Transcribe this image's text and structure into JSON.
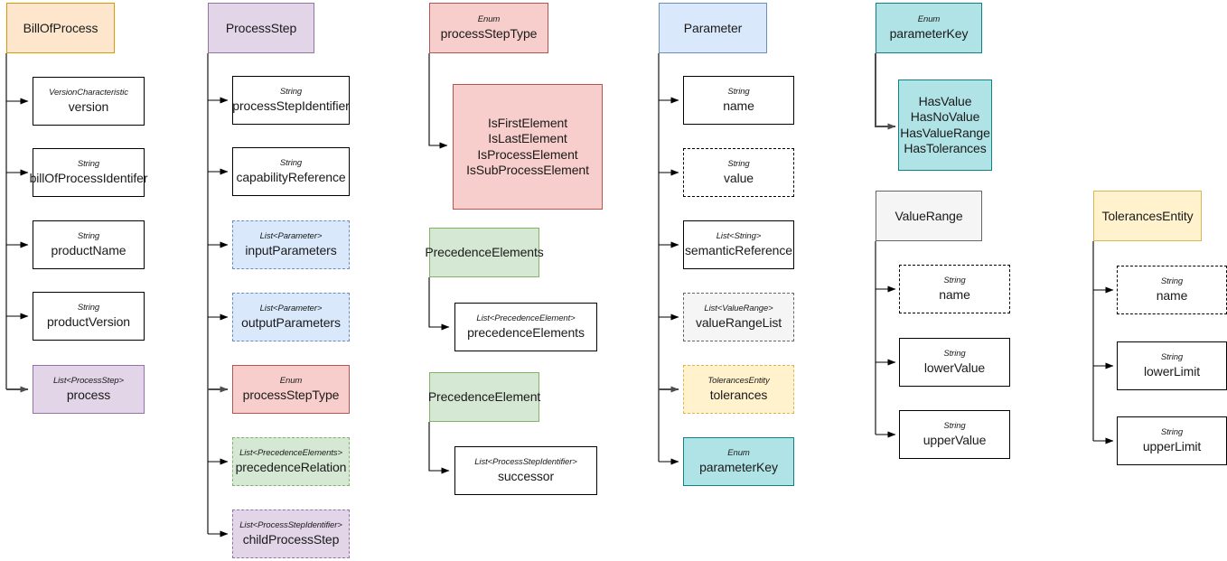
{
  "diagram": {
    "title": "BillOfProcess data model class diagram",
    "palette": {
      "orange_fill": "#FDE6CC",
      "orange_stroke": "#D79B00",
      "purple_fill": "#E1D5E7",
      "purple_stroke": "#9673A6",
      "red_fill": "#F8CECC",
      "red_stroke": "#B85450",
      "blue_fill": "#DAE8FC",
      "blue_stroke": "#6C8EBF",
      "teal_fill": "#B0E3E6",
      "teal_stroke": "#0E8088",
      "green_fill": "#D5E8D4",
      "green_stroke": "#82B366",
      "grey_fill": "#F5F5F5",
      "grey_stroke": "#666666",
      "yellow_fill": "#FFF2CC",
      "yellow_stroke": "#D6B656",
      "white_fill": "#FFFFFF",
      "black_stroke": "#000000"
    }
  },
  "classes": {
    "bill_of_process": {
      "name": "BillOfProcess"
    },
    "process_step": {
      "name": "ProcessStep"
    },
    "process_step_type": {
      "stereotype": "Enum",
      "name": "processStepType"
    },
    "parameter": {
      "name": "Parameter"
    },
    "parameter_key": {
      "stereotype": "Enum",
      "name": "parameterKey"
    },
    "precedence_elements": {
      "name": "PrecedenceElements"
    },
    "precedence_element": {
      "name": "PrecedenceElement"
    },
    "value_range": {
      "name": "ValueRange"
    },
    "tolerances_entity": {
      "name": "TolerancesEntity"
    }
  },
  "attributes": {
    "bop_version": {
      "type": "VersionCharacteristic",
      "name": "version"
    },
    "bop_identifier": {
      "type": "String",
      "name": "billOfProcessIdentifer"
    },
    "bop_product_name": {
      "type": "String",
      "name": "productName"
    },
    "bop_product_version": {
      "type": "String",
      "name": "productVersion"
    },
    "bop_process": {
      "type": "List<ProcessStep>",
      "name": "process"
    },
    "ps_identifier": {
      "type": "String",
      "name": "processStepIdentifier"
    },
    "ps_capability_ref": {
      "type": "String",
      "name": "capabilityReference"
    },
    "ps_input_parameters": {
      "type": "List<Parameter>",
      "name": "inputParameters"
    },
    "ps_output_parameters": {
      "type": "List<Parameter>",
      "name": "outputParameters"
    },
    "ps_process_step_type": {
      "type": "Enum",
      "name": "processStepType"
    },
    "ps_precedence_relation": {
      "type": "List<PrecedenceElements>",
      "name": "precedenceRelation"
    },
    "ps_child_process_step": {
      "type": "List<ProcessStepIdentifier>",
      "name": "childProcessStep"
    },
    "pst_values": {
      "type": "",
      "name": "IsFirstElement\nIsLastElement\nIsProcessElement\nIsSubProcessElement"
    },
    "pes_precedence_elements": {
      "type": "List<PrecedenceElement>",
      "name": "precedenceElements"
    },
    "pe_successor": {
      "type": "List<ProcessStepIdentifier>",
      "name": "successor"
    },
    "p_name": {
      "type": "String",
      "name": "name"
    },
    "p_value": {
      "type": "String",
      "name": "value"
    },
    "p_semantic_reference": {
      "type": "List<String>",
      "name": "semanticReference"
    },
    "p_value_range_list": {
      "type": "List<ValueRange>",
      "name": "valueRangeList"
    },
    "p_tolerances": {
      "type": "TolerancesEntity",
      "name": "tolerances"
    },
    "p_parameter_key": {
      "type": "Enum",
      "name": "parameterKey"
    },
    "pk_values": {
      "type": "",
      "name": "HasValue\nHasNoValue\nHasValueRange\nHasTolerances"
    },
    "vr_name": {
      "type": "String",
      "name": "name"
    },
    "vr_lower_value": {
      "type": "String",
      "name": "lowerValue"
    },
    "vr_upper_value": {
      "type": "String",
      "name": "upperValue"
    },
    "te_name": {
      "type": "String",
      "name": "name"
    },
    "te_lower_limit": {
      "type": "String",
      "name": "lowerLimit"
    },
    "te_upper_limit": {
      "type": "String",
      "name": "upperLimit"
    }
  }
}
